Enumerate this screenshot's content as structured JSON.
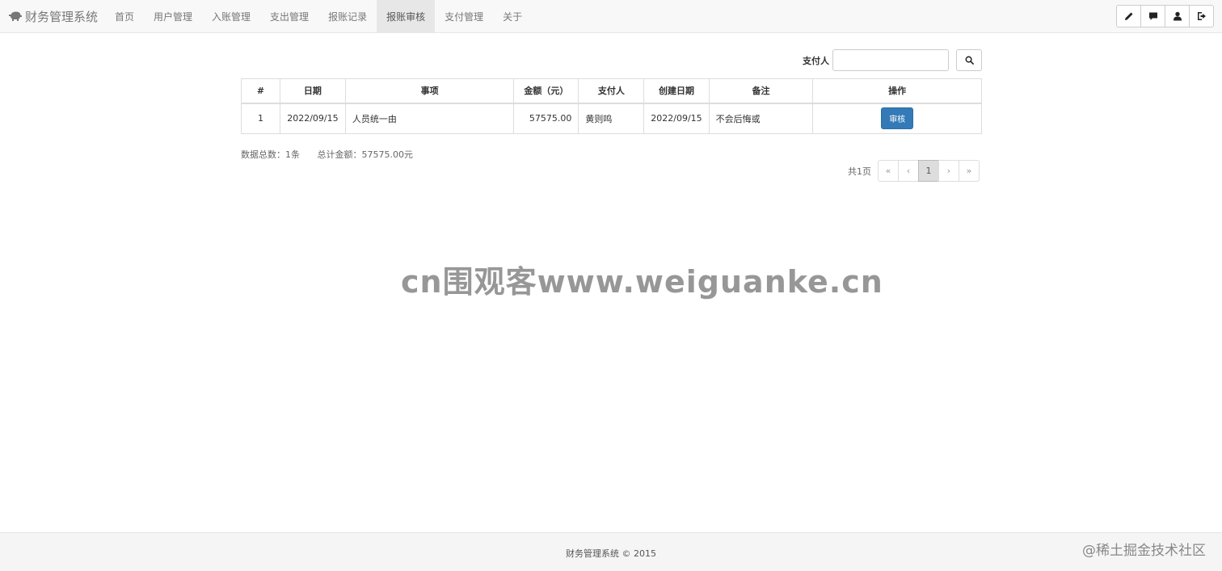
{
  "brand": {
    "title": "财务管理系统"
  },
  "nav": {
    "items": [
      {
        "label": "首页"
      },
      {
        "label": "用户管理"
      },
      {
        "label": "入账管理"
      },
      {
        "label": "支出管理"
      },
      {
        "label": "报账记录"
      },
      {
        "label": "报账审核",
        "active": true
      },
      {
        "label": "支付管理"
      },
      {
        "label": "关于"
      }
    ]
  },
  "toolbar": {
    "icons": [
      "pencil-icon",
      "comment-icon",
      "user-icon",
      "logout-icon"
    ]
  },
  "search": {
    "label": "支付人",
    "value": "",
    "placeholder": ""
  },
  "table": {
    "headers": [
      "#",
      "日期",
      "事项",
      "金额（元）",
      "支付人",
      "创建日期",
      "备注",
      "操作"
    ],
    "rows": [
      {
        "index": "1",
        "date": "2022/09/15",
        "item": "人员统一由",
        "amount": "57575.00",
        "payer": "黄则鸣",
        "created": "2022/09/15",
        "note": "不会后悔或",
        "action": "审核"
      }
    ]
  },
  "summary": {
    "total_count": "数据总数：1条",
    "total_amount": "总计金额：57575.00元"
  },
  "pager": {
    "text": "共1页",
    "first": "«",
    "prev": "‹",
    "current": "1",
    "next": "›",
    "last": "»"
  },
  "watermark": "cn围观客www.weiguanke.cn",
  "footer": {
    "text": "财务管理系统 © 2015",
    "mark": "@稀土掘金技术社区"
  },
  "colors": {
    "primary": "#337ab7",
    "navbar_bg": "#f8f8f8",
    "footer_bg": "#f5f5f5"
  }
}
